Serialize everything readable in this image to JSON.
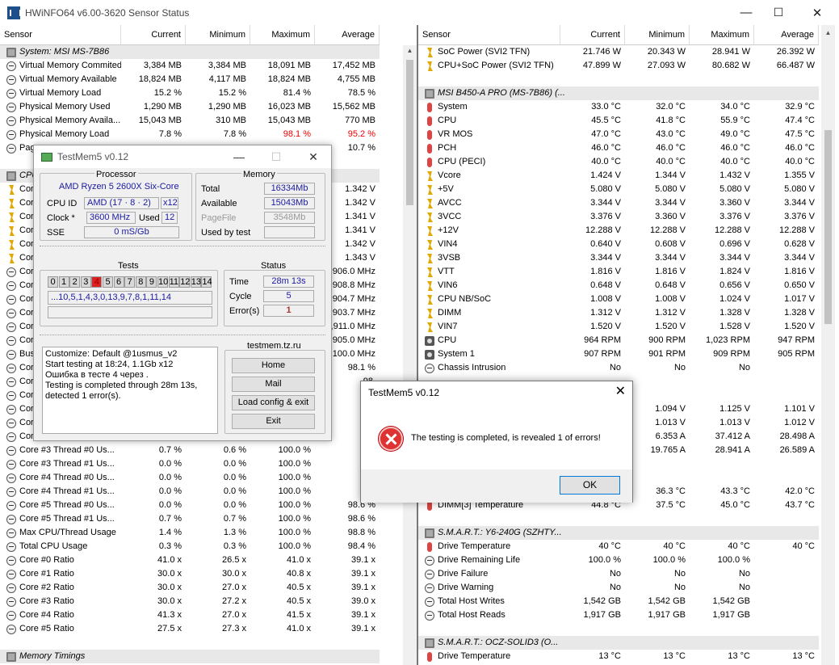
{
  "window": {
    "title": "HWiNFO64 v6.00-3620 Sensor Status",
    "minimize": "—",
    "maximize": "☐",
    "close": "✕"
  },
  "left": {
    "headers": [
      "Sensor",
      "Current",
      "Minimum",
      "Maximum",
      "Average"
    ],
    "rows": [
      {
        "type": "group",
        "name": "System: MSI MS-7B86",
        "icon": "chip"
      },
      {
        "icon": "clock",
        "name": "Virtual Memory Commited",
        "cur": "3,384 MB",
        "min": "3,384 MB",
        "max": "18,091 MB",
        "avg": "17,452 MB"
      },
      {
        "icon": "clock",
        "name": "Virtual Memory Available",
        "cur": "18,824 MB",
        "min": "4,117 MB",
        "max": "18,824 MB",
        "avg": "4,755 MB"
      },
      {
        "icon": "clock",
        "name": "Virtual Memory Load",
        "cur": "15.2 %",
        "min": "15.2 %",
        "max": "81.4 %",
        "avg": "78.5 %"
      },
      {
        "icon": "clock",
        "name": "Physical Memory Used",
        "cur": "1,290 MB",
        "min": "1,290 MB",
        "max": "16,023 MB",
        "avg": "15,562 MB"
      },
      {
        "icon": "clock",
        "name": "Physical Memory Availa...",
        "cur": "15,043 MB",
        "min": "310 MB",
        "max": "15,043 MB",
        "avg": "770 MB"
      },
      {
        "icon": "clock",
        "name": "Physical Memory Load",
        "cur": "7.8 %",
        "min": "7.8 %",
        "max": "98.1 %",
        "avg": "95.2 %",
        "red": true
      },
      {
        "icon": "clock",
        "name": "Pag",
        "cur": "",
        "min": "",
        "max": "",
        "avg": "10.7 %"
      },
      {
        "type": "sep"
      },
      {
        "type": "group",
        "name": "CPU",
        "icon": "chip"
      },
      {
        "icon": "bolt",
        "name": "Core",
        "cur": "",
        "min": "",
        "max": "",
        "avg": "1.342 V"
      },
      {
        "icon": "bolt",
        "name": "Core",
        "cur": "",
        "min": "",
        "max": "",
        "avg": "1.342 V"
      },
      {
        "icon": "bolt",
        "name": "Core",
        "cur": "",
        "min": "",
        "max": "",
        "avg": "1.341 V"
      },
      {
        "icon": "bolt",
        "name": "Core",
        "cur": "",
        "min": "",
        "max": "",
        "avg": "1.341 V"
      },
      {
        "icon": "bolt",
        "name": "Core",
        "cur": "",
        "min": "",
        "max": "",
        "avg": "1.342 V"
      },
      {
        "icon": "bolt",
        "name": "Core",
        "cur": "",
        "min": "",
        "max": "",
        "avg": "1.343 V"
      },
      {
        "icon": "clock",
        "name": "Core",
        "cur": "",
        "min": "",
        "max": "",
        "avg": "3,906.0 MHz"
      },
      {
        "icon": "clock",
        "name": "Core",
        "cur": "",
        "min": "",
        "max": "",
        "avg": "3,908.8 MHz"
      },
      {
        "icon": "clock",
        "name": "Core",
        "cur": "",
        "min": "",
        "max": "",
        "avg": "3,904.7 MHz"
      },
      {
        "icon": "clock",
        "name": "Core",
        "cur": "",
        "min": "",
        "max": "",
        "avg": "3,903.7 MHz"
      },
      {
        "icon": "clock",
        "name": "Core",
        "cur": "",
        "min": "",
        "max": "",
        "avg": "3,911.0 MHz"
      },
      {
        "icon": "clock",
        "name": "Core",
        "cur": "",
        "min": "",
        "max": "",
        "avg": "3,905.0 MHz"
      },
      {
        "icon": "clock",
        "name": "Bus",
        "cur": "",
        "min": "",
        "max": "",
        "avg": "100.0 MHz"
      },
      {
        "icon": "clock",
        "name": "Core",
        "cur": "",
        "min": "",
        "max": "",
        "avg": "98.1 %"
      },
      {
        "icon": "clock",
        "name": "Core",
        "cur": "",
        "min": "",
        "max": "",
        "avg": "98."
      },
      {
        "icon": "clock",
        "name": "Core",
        "cur": "",
        "min": "",
        "max": "",
        "avg": "98."
      },
      {
        "icon": "clock",
        "name": "Core",
        "cur": "",
        "min": "",
        "max": "",
        "avg": "98."
      },
      {
        "icon": "clock",
        "name": "Core",
        "cur": "",
        "min": "",
        "max": "",
        "avg": "98."
      },
      {
        "icon": "clock",
        "name": "Core",
        "cur": "",
        "min": "",
        "max": "",
        "avg": "98."
      },
      {
        "icon": "clock",
        "name": "Core #3 Thread #0 Us...",
        "cur": "0.7 %",
        "min": "0.6 %",
        "max": "100.0 %",
        "avg": "98."
      },
      {
        "icon": "clock",
        "name": "Core #3 Thread #1 Us...",
        "cur": "0.0 %",
        "min": "0.0 %",
        "max": "100.0 %",
        "avg": "98."
      },
      {
        "icon": "clock",
        "name": "Core #4 Thread #0 Us...",
        "cur": "0.0 %",
        "min": "0.0 %",
        "max": "100.0 %",
        "avg": "98."
      },
      {
        "icon": "clock",
        "name": "Core #4 Thread #1 Us...",
        "cur": "0.0 %",
        "min": "0.0 %",
        "max": "100.0 %",
        "avg": "98."
      },
      {
        "icon": "clock",
        "name": "Core #5 Thread #0 Us...",
        "cur": "0.0 %",
        "min": "0.0 %",
        "max": "100.0 %",
        "avg": "98.6 %"
      },
      {
        "icon": "clock",
        "name": "Core #5 Thread #1 Us...",
        "cur": "0.7 %",
        "min": "0.7 %",
        "max": "100.0 %",
        "avg": "98.6 %"
      },
      {
        "icon": "clock",
        "name": "Max CPU/Thread Usage",
        "cur": "1.4 %",
        "min": "1.3 %",
        "max": "100.0 %",
        "avg": "98.8 %"
      },
      {
        "icon": "clock",
        "name": "Total CPU Usage",
        "cur": "0.3 %",
        "min": "0.3 %",
        "max": "100.0 %",
        "avg": "98.4 %"
      },
      {
        "icon": "clock",
        "name": "Core #0 Ratio",
        "cur": "41.0 x",
        "min": "26.5 x",
        "max": "41.0 x",
        "avg": "39.1 x"
      },
      {
        "icon": "clock",
        "name": "Core #1 Ratio",
        "cur": "30.0 x",
        "min": "30.0 x",
        "max": "40.8 x",
        "avg": "39.1 x"
      },
      {
        "icon": "clock",
        "name": "Core #2 Ratio",
        "cur": "30.0 x",
        "min": "27.0 x",
        "max": "40.5 x",
        "avg": "39.1 x"
      },
      {
        "icon": "clock",
        "name": "Core #3 Ratio",
        "cur": "30.0 x",
        "min": "27.2 x",
        "max": "40.5 x",
        "avg": "39.0 x"
      },
      {
        "icon": "clock",
        "name": "Core #4 Ratio",
        "cur": "41.3 x",
        "min": "27.0 x",
        "max": "41.5 x",
        "avg": "39.1 x"
      },
      {
        "icon": "clock",
        "name": "Core #5 Ratio",
        "cur": "27.5 x",
        "min": "27.3 x",
        "max": "41.0 x",
        "avg": "39.1 x"
      },
      {
        "type": "sep"
      },
      {
        "type": "group",
        "name": "Memory Timings",
        "icon": "chip"
      }
    ]
  },
  "right": {
    "headers": [
      "Sensor",
      "Current",
      "Minimum",
      "Maximum",
      "Average"
    ],
    "rows": [
      {
        "icon": "bolt",
        "name": "SoC Power (SVI2 TFN)",
        "cur": "21.746 W",
        "min": "20.343 W",
        "max": "28.941 W",
        "avg": "26.392 W"
      },
      {
        "icon": "bolt",
        "name": "CPU+SoC Power (SVI2 TFN)",
        "cur": "47.899 W",
        "min": "27.093 W",
        "max": "80.682 W",
        "avg": "66.487 W"
      },
      {
        "type": "sep"
      },
      {
        "type": "group",
        "name": "MSI B450-A PRO (MS-7B86) (...",
        "icon": "chip"
      },
      {
        "icon": "therm",
        "name": "System",
        "cur": "33.0 °C",
        "min": "32.0 °C",
        "max": "34.0 °C",
        "avg": "32.9 °C"
      },
      {
        "icon": "therm",
        "name": "CPU",
        "cur": "45.5 °C",
        "min": "41.8 °C",
        "max": "55.9 °C",
        "avg": "47.4 °C"
      },
      {
        "icon": "therm",
        "name": "VR MOS",
        "cur": "47.0 °C",
        "min": "43.0 °C",
        "max": "49.0 °C",
        "avg": "47.5 °C"
      },
      {
        "icon": "therm",
        "name": "PCH",
        "cur": "46.0 °C",
        "min": "46.0 °C",
        "max": "46.0 °C",
        "avg": "46.0 °C"
      },
      {
        "icon": "therm",
        "name": "CPU (PECI)",
        "cur": "40.0 °C",
        "min": "40.0 °C",
        "max": "40.0 °C",
        "avg": "40.0 °C"
      },
      {
        "icon": "bolt",
        "name": "Vcore",
        "cur": "1.424 V",
        "min": "1.344 V",
        "max": "1.432 V",
        "avg": "1.355 V"
      },
      {
        "icon": "bolt",
        "name": "+5V",
        "cur": "5.080 V",
        "min": "5.080 V",
        "max": "5.080 V",
        "avg": "5.080 V"
      },
      {
        "icon": "bolt",
        "name": "AVCC",
        "cur": "3.344 V",
        "min": "3.344 V",
        "max": "3.360 V",
        "avg": "3.344 V"
      },
      {
        "icon": "bolt",
        "name": "3VCC",
        "cur": "3.376 V",
        "min": "3.360 V",
        "max": "3.376 V",
        "avg": "3.376 V"
      },
      {
        "icon": "bolt",
        "name": "+12V",
        "cur": "12.288 V",
        "min": "12.288 V",
        "max": "12.288 V",
        "avg": "12.288 V"
      },
      {
        "icon": "bolt",
        "name": "VIN4",
        "cur": "0.640 V",
        "min": "0.608 V",
        "max": "0.696 V",
        "avg": "0.628 V"
      },
      {
        "icon": "bolt",
        "name": "3VSB",
        "cur": "3.344 V",
        "min": "3.344 V",
        "max": "3.344 V",
        "avg": "3.344 V"
      },
      {
        "icon": "bolt",
        "name": "VTT",
        "cur": "1.816 V",
        "min": "1.816 V",
        "max": "1.824 V",
        "avg": "1.816 V"
      },
      {
        "icon": "bolt",
        "name": "VIN6",
        "cur": "0.648 V",
        "min": "0.648 V",
        "max": "0.656 V",
        "avg": "0.650 V"
      },
      {
        "icon": "bolt",
        "name": "CPU NB/SoC",
        "cur": "1.008 V",
        "min": "1.008 V",
        "max": "1.024 V",
        "avg": "1.017 V"
      },
      {
        "icon": "bolt",
        "name": "DIMM",
        "cur": "1.312 V",
        "min": "1.312 V",
        "max": "1.328 V",
        "avg": "1.328 V"
      },
      {
        "icon": "bolt",
        "name": "VIN7",
        "cur": "1.520 V",
        "min": "1.520 V",
        "max": "1.528 V",
        "avg": "1.520 V"
      },
      {
        "icon": "fan",
        "name": "CPU",
        "cur": "964 RPM",
        "min": "900 RPM",
        "max": "1,023 RPM",
        "avg": "947 RPM"
      },
      {
        "icon": "fan",
        "name": "System 1",
        "cur": "907 RPM",
        "min": "901 RPM",
        "max": "909 RPM",
        "avg": "905 RPM"
      },
      {
        "icon": "clock",
        "name": "Chassis Intrusion",
        "cur": "No",
        "min": "No",
        "max": "No",
        "avg": ""
      },
      {
        "type": "sep"
      },
      {
        "type": "sep"
      },
      {
        "icon": "bolt",
        "name": "",
        "cur": "",
        "min": "1.094 V",
        "max": "1.125 V",
        "avg": "1.101 V"
      },
      {
        "icon": "bolt",
        "name": "",
        "cur": "",
        "min": "1.013 V",
        "max": "1.013 V",
        "avg": "1.012 V"
      },
      {
        "icon": "bolt",
        "name": "",
        "cur": "",
        "min": "6.353 A",
        "max": "37.412 A",
        "avg": "28.498 A"
      },
      {
        "icon": "bolt",
        "name": "",
        "cur": "",
        "min": "19.765 A",
        "max": "28.941 A",
        "avg": "26.589 A"
      },
      {
        "type": "sep"
      },
      {
        "type": "sep"
      },
      {
        "icon": "therm",
        "name": "",
        "cur": "",
        "min": "36.3 °C",
        "max": "43.3 °C",
        "avg": "42.0 °C"
      },
      {
        "icon": "therm",
        "name": "DIMM[3] Temperature",
        "cur": "44.8 °C",
        "min": "37.5 °C",
        "max": "45.0 °C",
        "avg": "43.7 °C"
      },
      {
        "type": "sep"
      },
      {
        "type": "group",
        "name": "S.M.A.R.T.: Y6-240G (SZHTY...",
        "icon": "chip"
      },
      {
        "icon": "therm",
        "name": "Drive Temperature",
        "cur": "40 °C",
        "min": "40 °C",
        "max": "40 °C",
        "avg": "40 °C"
      },
      {
        "icon": "clock",
        "name": "Drive Remaining Life",
        "cur": "100.0 %",
        "min": "100.0 %",
        "max": "100.0 %",
        "avg": ""
      },
      {
        "icon": "clock",
        "name": "Drive Failure",
        "cur": "No",
        "min": "No",
        "max": "No",
        "avg": ""
      },
      {
        "icon": "clock",
        "name": "Drive Warning",
        "cur": "No",
        "min": "No",
        "max": "No",
        "avg": ""
      },
      {
        "icon": "clock",
        "name": "Total Host Writes",
        "cur": "1,542 GB",
        "min": "1,542 GB",
        "max": "1,542 GB",
        "avg": ""
      },
      {
        "icon": "clock",
        "name": "Total Host Reads",
        "cur": "1,917 GB",
        "min": "1,917 GB",
        "max": "1,917 GB",
        "avg": ""
      },
      {
        "type": "sep"
      },
      {
        "type": "group",
        "name": "S.M.A.R.T.: OCZ-SOLID3 (O...",
        "icon": "chip"
      },
      {
        "icon": "therm",
        "name": "Drive Temperature",
        "cur": "13 °C",
        "min": "13 °C",
        "max": "13 °C",
        "avg": "13 °C"
      }
    ]
  },
  "testmem": {
    "title": "TestMem5 v0.12",
    "processor_label": "Processor",
    "cpu_name": "AMD Ryzen 5 2600X Six-Core",
    "cpu_id_label": "CPU ID",
    "cpu_id_value": "AMD  (17 · 8 · 2)",
    "cpu_threads": "x12",
    "clock_label": "Clock *",
    "clock_value": "3600 MHz",
    "used_label": "Used",
    "used_value": "12",
    "sse_label": "SSE",
    "sse_value": "0 mS/Gb",
    "memory_label": "Memory",
    "total_label": "Total",
    "total_value": "16334Mb",
    "available_label": "Available",
    "available_value": "15043Mb",
    "pagefile_label": "PageFile",
    "pagefile_value": "3548Mb",
    "usedbytest_label": "Used by test",
    "usedbytest_value": "",
    "tests_label": "Tests",
    "tests": [
      "0",
      "1",
      "2",
      "3",
      "4",
      "5",
      "6",
      "7",
      "8",
      "9",
      "10",
      "11",
      "12",
      "13",
      "14"
    ],
    "failed_test": "4",
    "sequence": "...10,5,1,4,3,0,13,9,7,8,1,11,14",
    "status_label": "Status",
    "time_label": "Time",
    "time_value": "28m 13s",
    "cycle_label": "Cycle",
    "cycle_value": "5",
    "errors_label": "Error(s)",
    "errors_value": "1",
    "site_label": "testmem.tz.ru",
    "btn_home": "Home",
    "btn_mail": "Mail",
    "btn_load": "Load config & exit",
    "btn_exit": "Exit",
    "log": "Customize: Default @1usmus_v2\nStart testing at 18:24, 1.1Gb x12\nОшибка в тесте 4 через .\nTesting is completed through 28m 13s,\ndetected 1 error(s)."
  },
  "dialog": {
    "title": "TestMem5 v0.12",
    "message": "The testing is completed, is revealed 1 of errors!",
    "ok": "OK",
    "close": "✕"
  }
}
